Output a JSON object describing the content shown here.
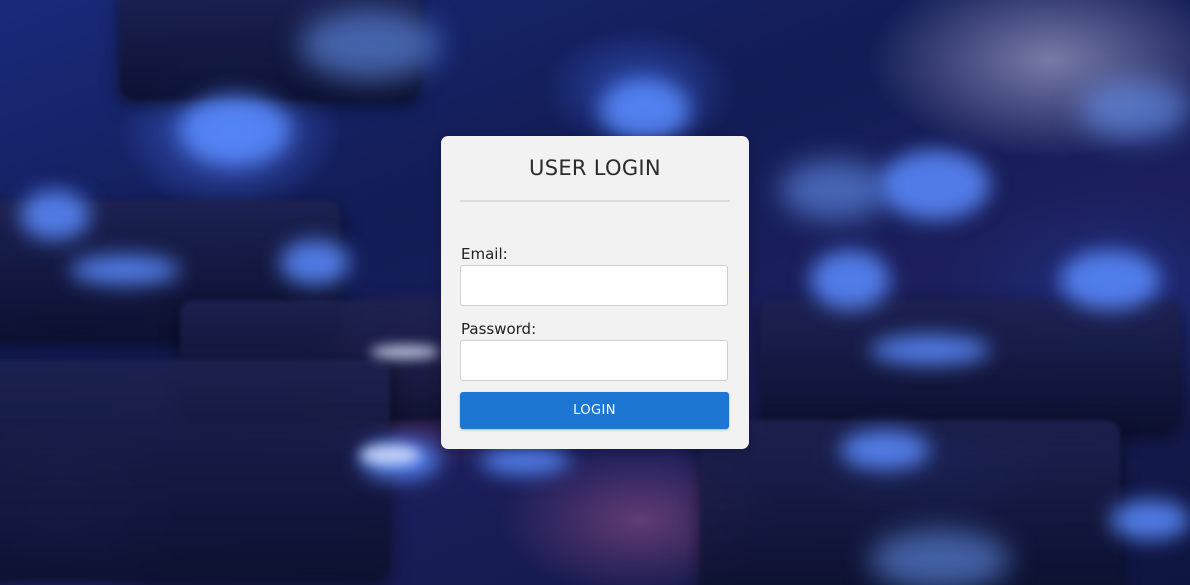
{
  "login": {
    "title": "USER LOGIN",
    "email_label": "Email:",
    "email_value": "",
    "password_label": "Password:",
    "password_value": "",
    "button_label": "LOGIN"
  },
  "colors": {
    "card_background": "#f2f2f2",
    "button_background": "#1d77d2",
    "button_text": "#ffffff",
    "background_accent": "#1a2a7a"
  }
}
